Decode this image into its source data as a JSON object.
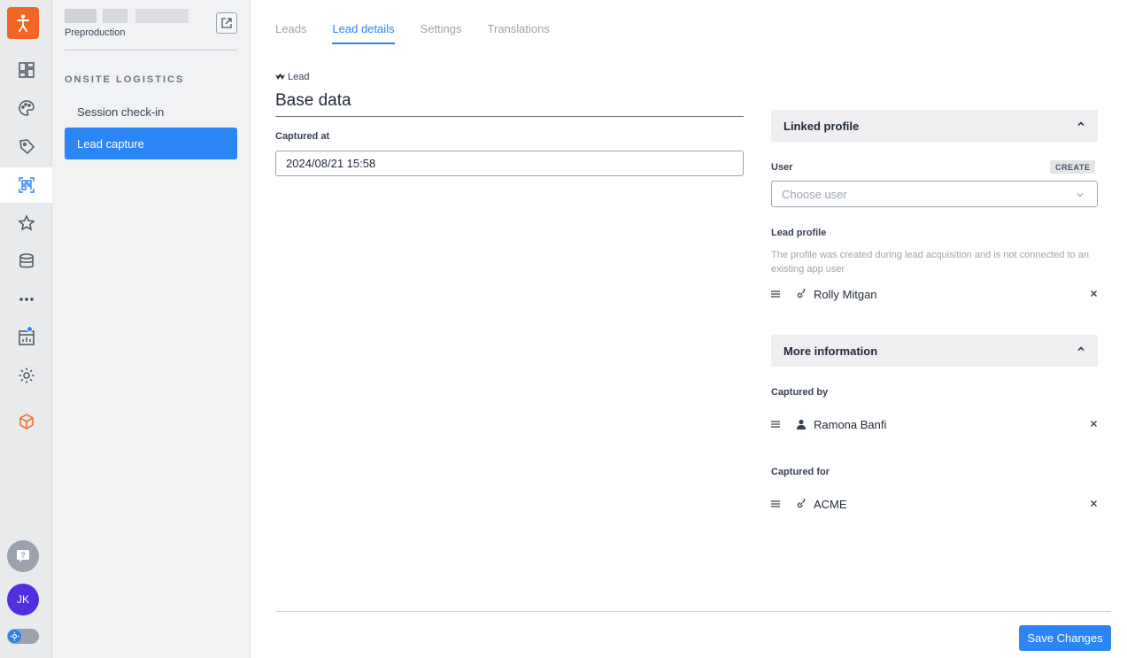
{
  "rail": {
    "items": [
      {
        "icon": "dashboard-icon"
      },
      {
        "icon": "palette-icon"
      },
      {
        "icon": "tag-icon"
      },
      {
        "icon": "qr-scan-icon",
        "active": true
      },
      {
        "icon": "star-icon"
      },
      {
        "icon": "database-icon"
      },
      {
        "icon": "more-icon"
      },
      {
        "icon": "analytics-icon"
      },
      {
        "icon": "settings-icon"
      },
      {
        "icon": "box-icon"
      }
    ],
    "avatar_initials": "JK",
    "accent": "#2b85f5",
    "brand": "#f26522"
  },
  "nav": {
    "environment": "Preproduction",
    "section_title": "ONSITE LOGISTICS",
    "items": [
      {
        "label": "Session check-in",
        "active": false
      },
      {
        "label": "Lead capture",
        "active": true
      }
    ]
  },
  "tabs": [
    {
      "label": "Leads",
      "active": false
    },
    {
      "label": "Lead details",
      "active": true
    },
    {
      "label": "Settings",
      "active": false
    },
    {
      "label": "Translations",
      "active": false
    }
  ],
  "lead": {
    "tag": "Lead",
    "title": "Base data",
    "captured_at_label": "Captured at",
    "captured_at_value": "2024/08/21 15:58"
  },
  "linked_profile": {
    "header": "Linked profile",
    "user_label": "User",
    "create_label": "CREATE",
    "user_placeholder": "Choose user",
    "lead_profile_label": "Lead profile",
    "lead_profile_hint": "The profile was created during lead acquisition and is not connected to an existing app user",
    "lead_profile_name": "Rolly Mitgan"
  },
  "more_information": {
    "header": "More information",
    "captured_by_label": "Captured by",
    "captured_by_name": "Ramona Banfi",
    "captured_for_label": "Captured for",
    "captured_for_name": "ACME"
  },
  "footer": {
    "save_label": "Save Changes"
  }
}
